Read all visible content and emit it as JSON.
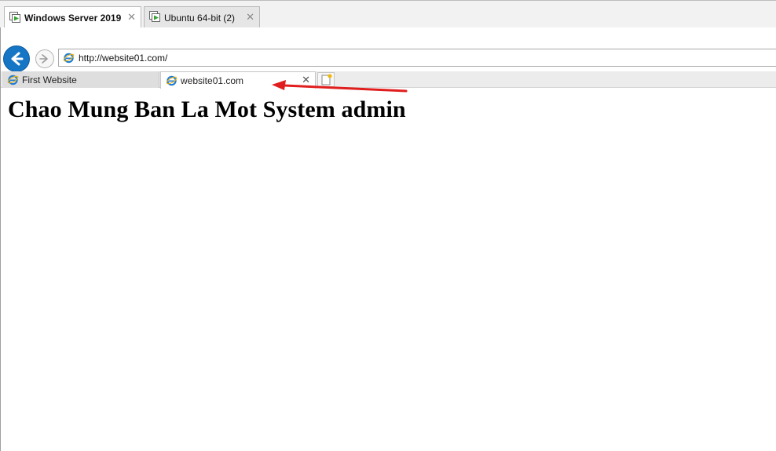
{
  "vm_tabs": [
    {
      "label": "Windows Server 2019",
      "active": true,
      "icon": "vm-play-icon"
    },
    {
      "label": "Ubuntu 64-bit (2)",
      "active": false,
      "icon": "vm-play-icon"
    }
  ],
  "browser": {
    "address": {
      "url": "http://website01.com/",
      "icon": "ie-icon"
    },
    "tabs": [
      {
        "label": "First Website",
        "icon": "ie-icon",
        "active": false
      },
      {
        "label": "website01.com",
        "icon": "ie-icon",
        "active": true
      }
    ]
  },
  "page": {
    "heading": "Chao Mung Ban La Mot System admin"
  },
  "colors": {
    "back_button": "#1676c6",
    "annotation_arrow": "#e01e1e",
    "vm_play_green": "#3aa335",
    "ie_blue": "#1e7bd6"
  }
}
